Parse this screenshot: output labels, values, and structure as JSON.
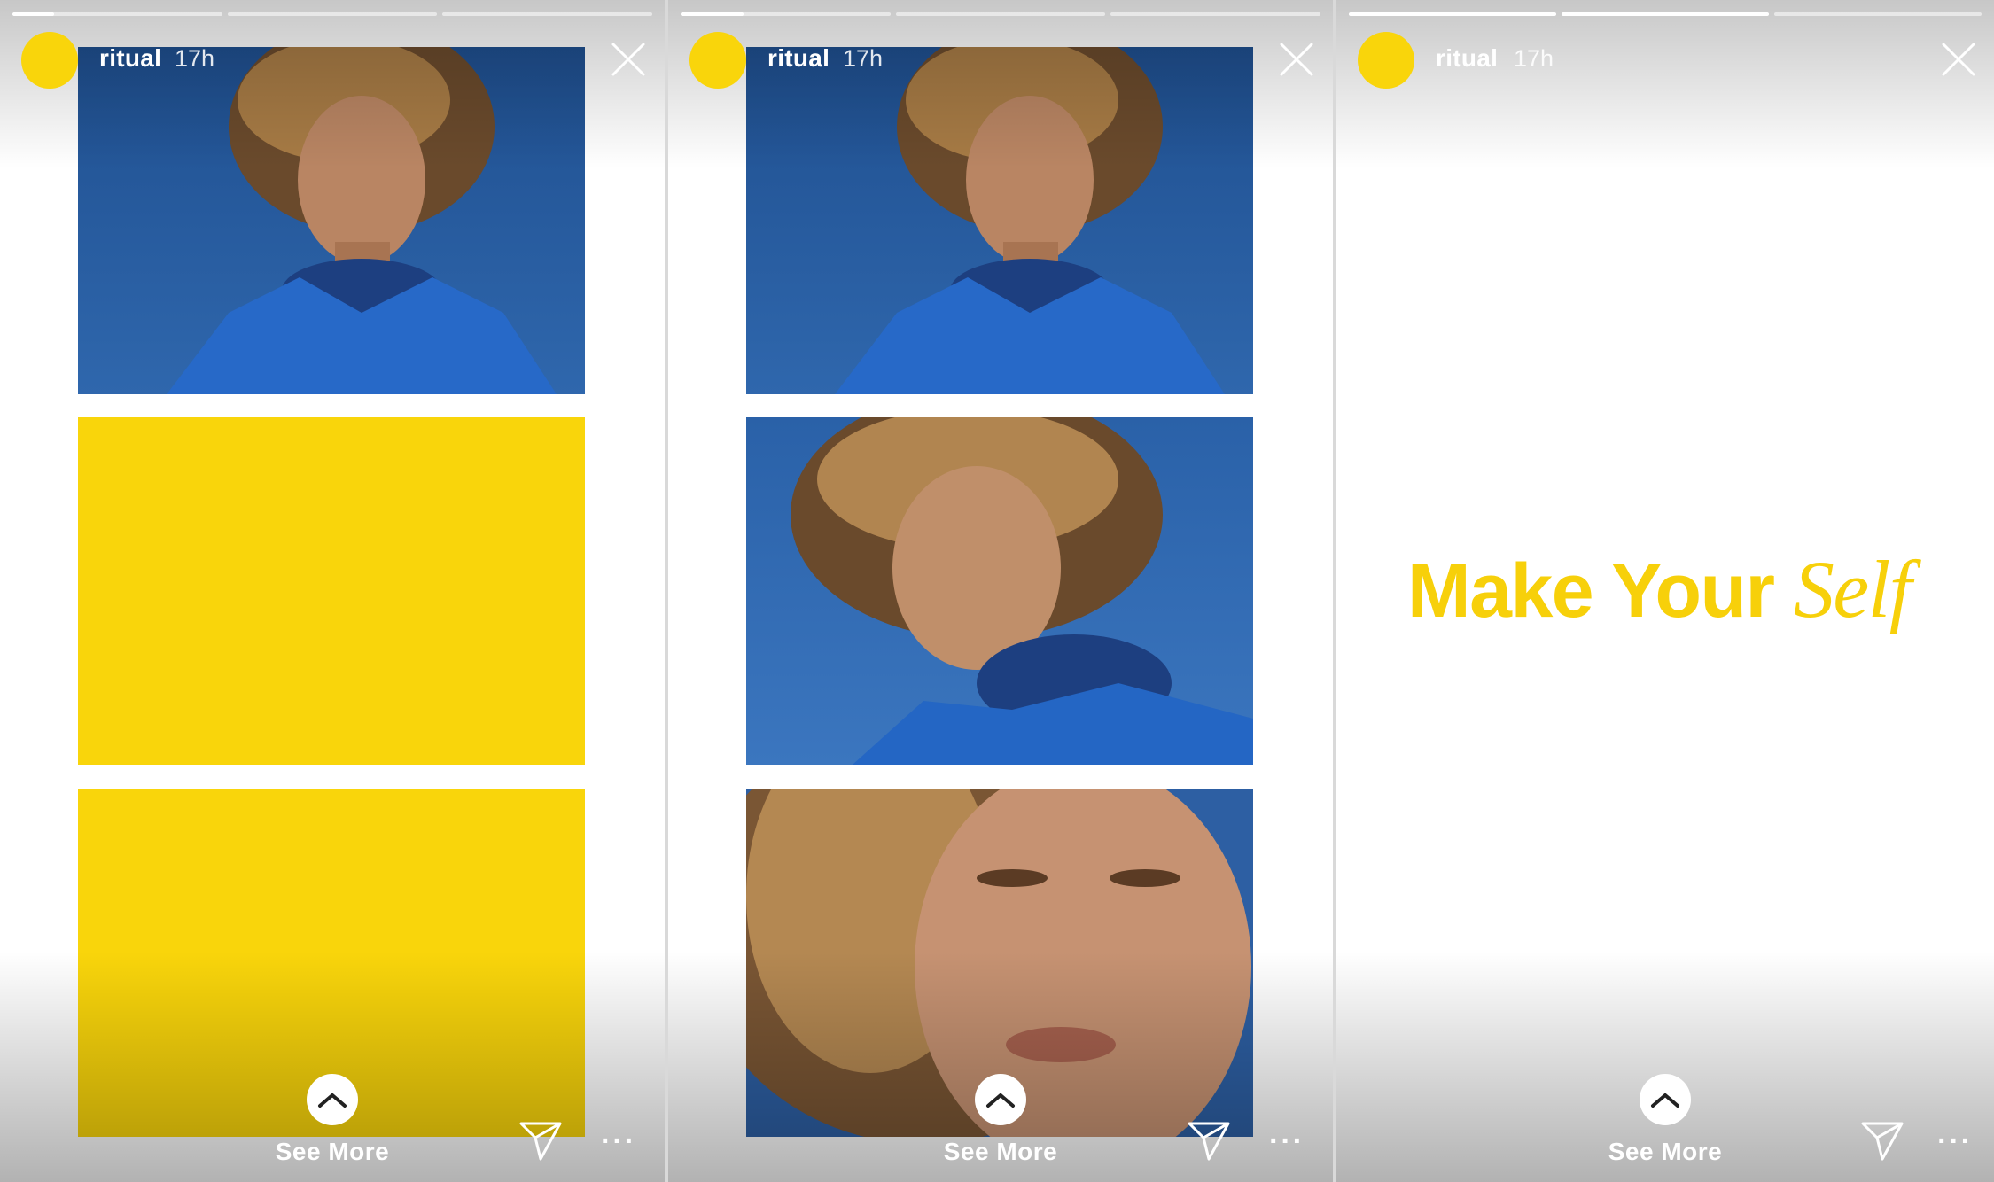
{
  "colors": {
    "brand_yellow": "#f9d50b",
    "sky_blue": "#2d5fa3"
  },
  "stories": [
    {
      "username": "ritual",
      "time": "17h",
      "progress": [
        0.2,
        0,
        0
      ],
      "media": [
        "woman-photo",
        "yellow-block",
        "yellow-block"
      ],
      "see_more": "See More"
    },
    {
      "username": "ritual",
      "time": "17h",
      "progress": [
        0.3,
        0,
        0
      ],
      "media": [
        "woman-photo",
        "woman-photo",
        "woman-photo"
      ],
      "see_more": "See More"
    },
    {
      "username": "ritual",
      "time": "17h",
      "progress": [
        1,
        1,
        0
      ],
      "tagline": {
        "main": "Make Your",
        "script": "Self"
      },
      "see_more": "See More"
    }
  ]
}
